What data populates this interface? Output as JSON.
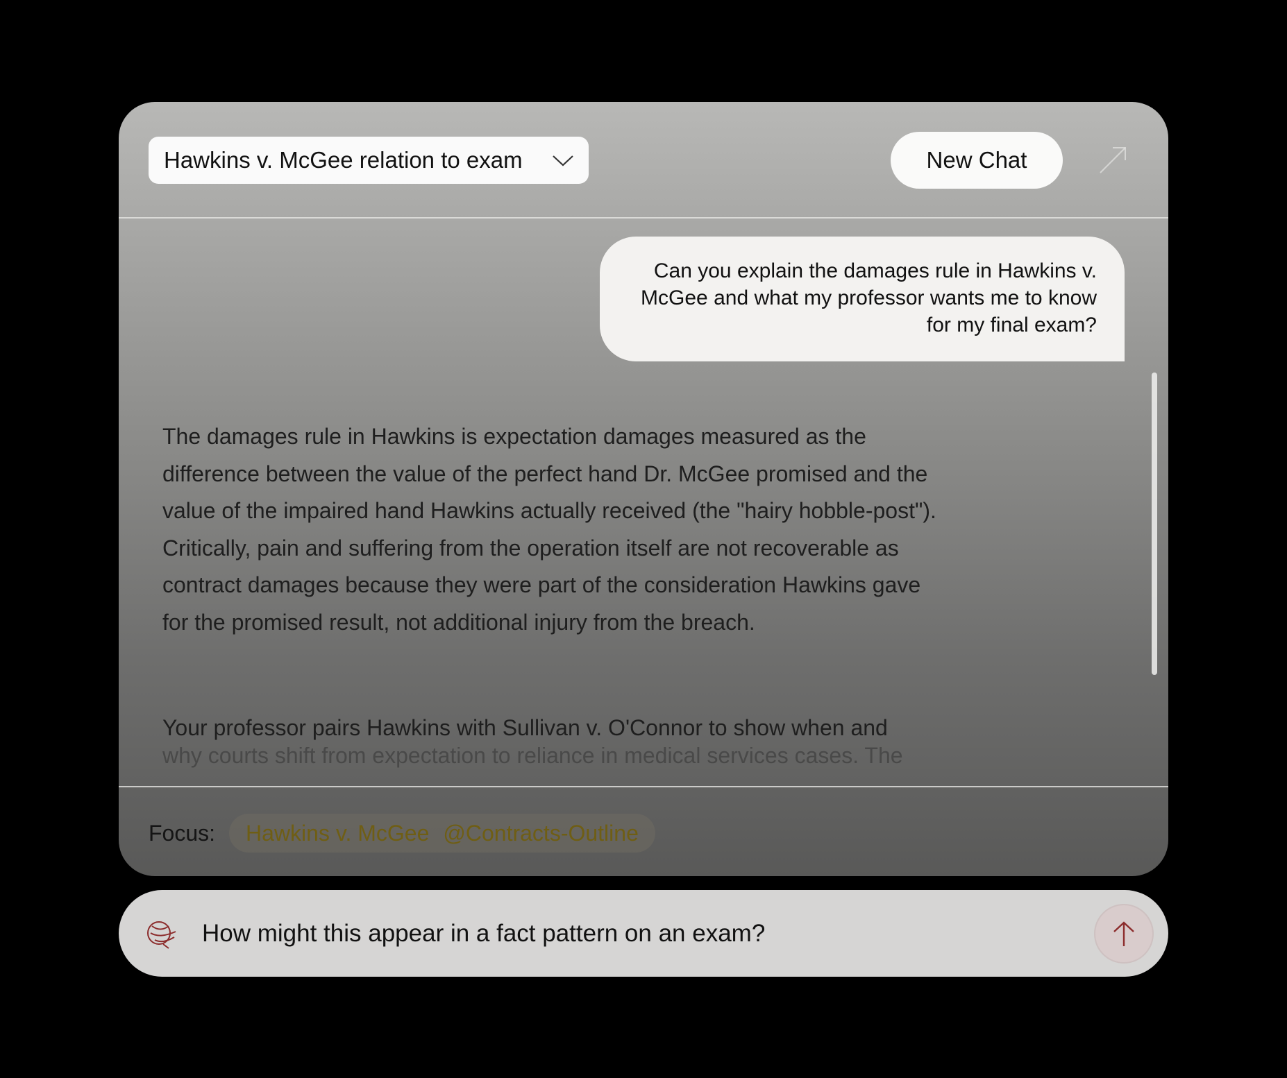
{
  "header": {
    "chat_title": "Hawkins v. McGee relation to exam",
    "new_chat_label": "New Chat"
  },
  "messages": {
    "user": "Can you explain the damages rule in Hawkins v. McGee and what my professor wants me to know for my final exam?",
    "assistant_p1": "The damages rule in Hawkins is expectation damages measured as the difference between the value of the perfect hand Dr. McGee promised and the value of the impaired hand Hawkins actually received (the \"hairy hobble-post\"). Critically, pain and suffering from the operation itself are not recoverable as contract damages because they were part of the consideration Hawkins gave for the promised result, not additional injury from the breach.",
    "assistant_p2": "Your professor pairs Hawkins with Sullivan v. O'Connor to show when and",
    "assistant_p2_cut": "why courts shift from expectation to reliance in medical services cases. The"
  },
  "focus": {
    "label": "Focus:",
    "chips": [
      "Hawkins v. McGee",
      "@Contracts-Outline"
    ]
  },
  "composer": {
    "value": "How might this appear in a fact pattern on an exam?"
  },
  "icons": {
    "title_dropdown": "chevron-down-icon",
    "expand": "expand-arrow-icon",
    "composer_logo": "assistant-logo-icon",
    "send": "arrow-up-icon"
  },
  "colors": {
    "chip_text": "#6f5e14",
    "logo": "#8c2c2c",
    "send_arrow": "#8c2c2c"
  }
}
